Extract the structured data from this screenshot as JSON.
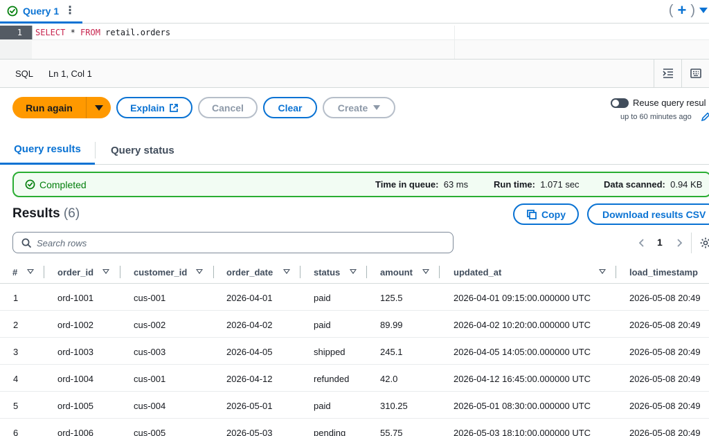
{
  "tab": {
    "label": "Query 1",
    "menu": "⋮",
    "paren_open": "(",
    "plus": "+",
    "paren_close": ")"
  },
  "editor": {
    "line_number": "1",
    "tokens": [
      {
        "text": "SELECT",
        "kind": "keyword"
      },
      {
        "text": " * ",
        "kind": "plain"
      },
      {
        "text": "FROM",
        "kind": "keyword"
      },
      {
        "text": " retail.orders",
        "kind": "plain"
      }
    ]
  },
  "statusbar": {
    "language": "SQL",
    "cursor": "Ln 1, Col 1"
  },
  "actions": {
    "run_again": "Run again",
    "explain": "Explain",
    "cancel": "Cancel",
    "clear": "Clear",
    "create": "Create"
  },
  "reuse": {
    "label": "Reuse query resul",
    "sublabel": "up to 60 minutes ago"
  },
  "result_tabs": {
    "results": "Query results",
    "status": "Query status"
  },
  "banner": {
    "status": "Completed",
    "queue_label": "Time in queue:",
    "queue_value": "63 ms",
    "runtime_label": "Run time:",
    "runtime_value": "1.071 sec",
    "scanned_label": "Data scanned:",
    "scanned_value": "0.94 KB"
  },
  "results": {
    "title": "Results",
    "count": "(6)",
    "copy": "Copy",
    "download": "Download results CSV",
    "search_placeholder": "Search rows",
    "page": "1"
  },
  "table": {
    "columns": [
      "#",
      "order_id",
      "customer_id",
      "order_date",
      "status",
      "amount",
      "updated_at",
      "load_timestamp"
    ],
    "rows": [
      [
        "1",
        "ord-1001",
        "cus-001",
        "2026-04-01",
        "paid",
        "125.5",
        "2026-04-01 09:15:00.000000 UTC",
        "2026-05-08 20:49"
      ],
      [
        "2",
        "ord-1002",
        "cus-002",
        "2026-04-02",
        "paid",
        "89.99",
        "2026-04-02 10:20:00.000000 UTC",
        "2026-05-08 20:49"
      ],
      [
        "3",
        "ord-1003",
        "cus-003",
        "2026-04-05",
        "shipped",
        "245.1",
        "2026-04-05 14:05:00.000000 UTC",
        "2026-05-08 20:49"
      ],
      [
        "4",
        "ord-1004",
        "cus-001",
        "2026-04-12",
        "refunded",
        "42.0",
        "2026-04-12 16:45:00.000000 UTC",
        "2026-05-08 20:49"
      ],
      [
        "5",
        "ord-1005",
        "cus-004",
        "2026-05-01",
        "paid",
        "310.25",
        "2026-05-01 08:30:00.000000 UTC",
        "2026-05-08 20:49"
      ],
      [
        "6",
        "ord-1006",
        "cus-005",
        "2026-05-03",
        "pending",
        "55.75",
        "2026-05-03 18:10:00.000000 UTC",
        "2026-05-08 20:49"
      ]
    ]
  },
  "colors": {
    "accent": "#0972d3",
    "run_button": "#ff9900",
    "success": "#037f0c",
    "success_border": "#29ad32"
  },
  "icons": {
    "tab_status": "check-circle-icon",
    "tab_menu": "vertical-ellipsis-icon",
    "new_tab": "plus-icon",
    "tab_dropdown": "caret-down-icon",
    "format_query": "indent-icon",
    "keyboard": "keyboard-icon",
    "run_dropdown": "caret-down-icon",
    "explain": "external-link-icon",
    "create_dropdown": "caret-down-icon",
    "reuse_edit": "pencil-icon",
    "completed": "check-circle-icon",
    "copy": "copy-icon",
    "search": "search-icon",
    "prev_page": "chevron-left-icon",
    "next_page": "chevron-right-icon",
    "preferences": "gear-icon",
    "column_sort": "sort-caret-icon"
  }
}
